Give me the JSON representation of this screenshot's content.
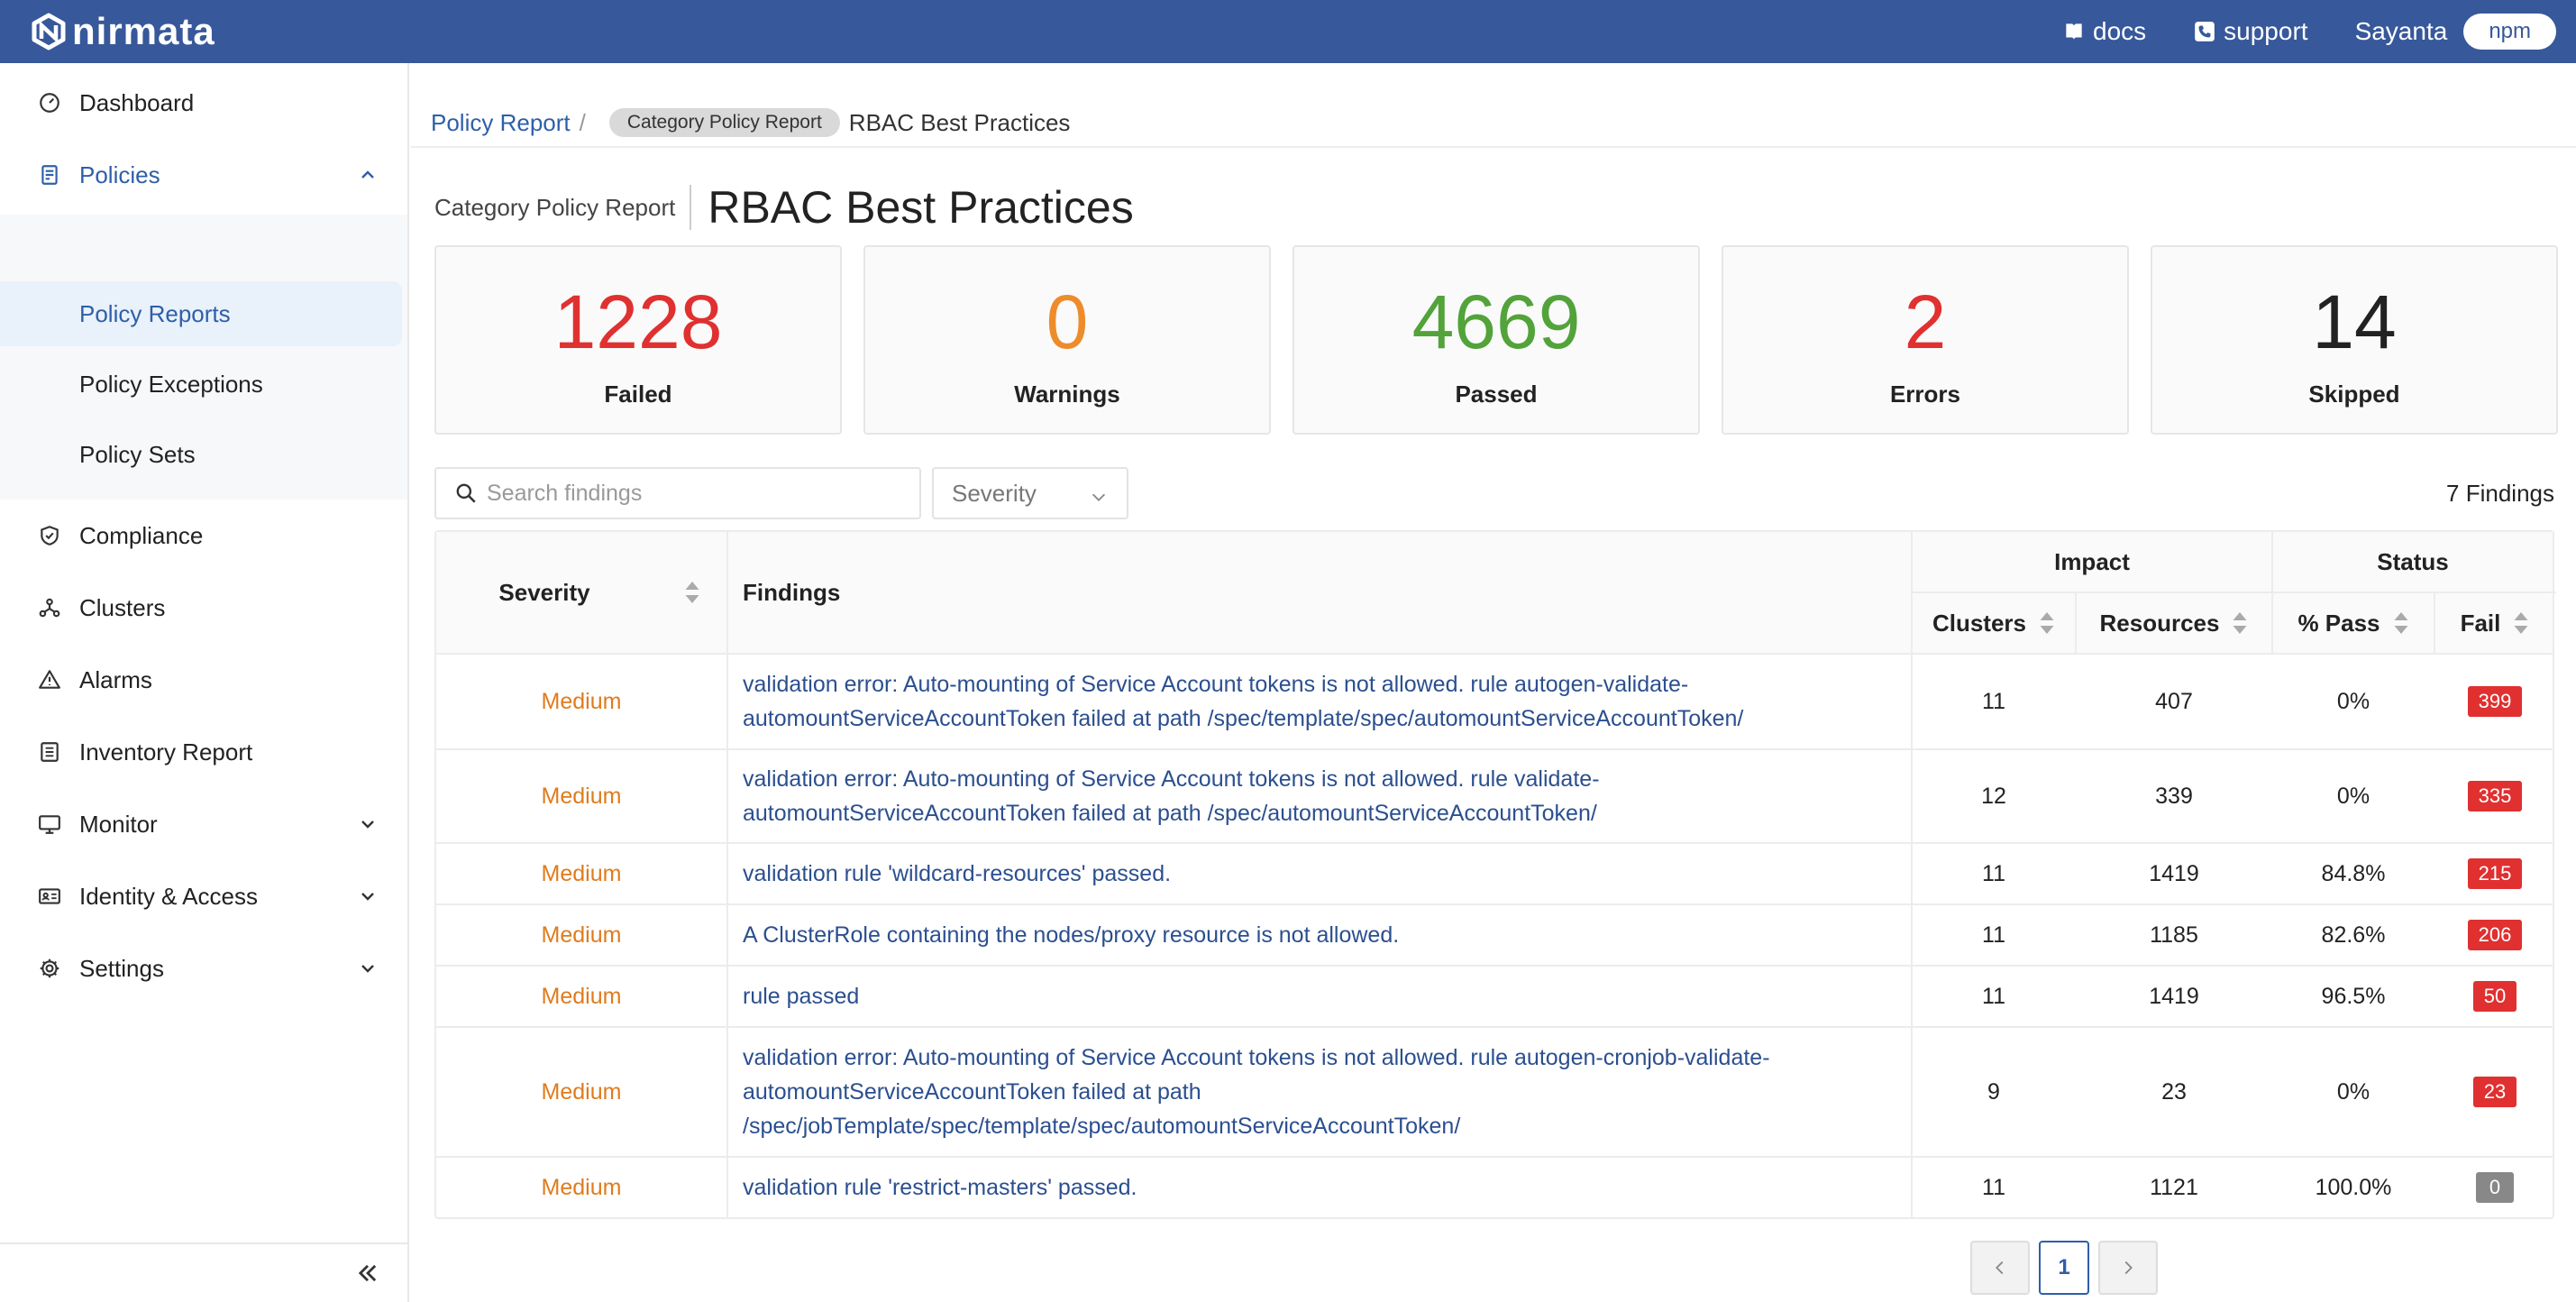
{
  "brand": {
    "name": "nirmata"
  },
  "topnav": {
    "docs": "docs",
    "support": "support",
    "user": "Sayanta",
    "org": "npm"
  },
  "sidebar": {
    "dashboard": "Dashboard",
    "policies": "Policies",
    "policy_reports": "Policy Reports",
    "policy_exceptions": "Policy Exceptions",
    "policy_sets": "Policy Sets",
    "compliance": "Compliance",
    "clusters": "Clusters",
    "alarms": "Alarms",
    "inventory_report": "Inventory Report",
    "monitor": "Monitor",
    "identity_access": "Identity & Access",
    "settings": "Settings"
  },
  "breadcrumb": {
    "root": "Policy Report",
    "sep": "/",
    "chip": "Category Policy Report",
    "current": "RBAC Best Practices"
  },
  "page": {
    "subtitle": "Category Policy Report",
    "title": "RBAC Best Practices"
  },
  "summary": {
    "failed": {
      "value": "1228",
      "label": "Failed",
      "color": "#e03030"
    },
    "warnings": {
      "value": "0",
      "label": "Warnings",
      "color": "#ee8c2b"
    },
    "passed": {
      "value": "4669",
      "label": "Passed",
      "color": "#52a33a"
    },
    "errors": {
      "value": "2",
      "label": "Errors",
      "color": "#e03030"
    },
    "skipped": {
      "value": "14",
      "label": "Skipped",
      "color": "#222222"
    }
  },
  "filters": {
    "search_placeholder": "Search findings",
    "severity": "Severity",
    "count": "7 Findings"
  },
  "table": {
    "headers": {
      "severity": "Severity",
      "findings": "Findings",
      "impact": "Impact",
      "status": "Status",
      "clusters": "Clusters",
      "resources": "Resources",
      "pass": "% Pass",
      "fail": "Fail"
    },
    "rows": [
      {
        "severity": "Medium",
        "finding": "validation error: Auto-mounting of Service Account tokens is not allowed. rule autogen-validate-automountServiceAccountToken failed at path /spec/template/spec/automountServiceAccountToken/",
        "clusters": "11",
        "resources": "407",
        "pass": "0%",
        "fail": "399",
        "fail_color": "#e03030"
      },
      {
        "severity": "Medium",
        "finding": "validation error: Auto-mounting of Service Account tokens is not allowed. rule validate-automountServiceAccountToken failed at path /spec/automountServiceAccountToken/",
        "clusters": "12",
        "resources": "339",
        "pass": "0%",
        "fail": "335",
        "fail_color": "#e03030"
      },
      {
        "severity": "Medium",
        "finding": "validation rule 'wildcard-resources' passed.",
        "clusters": "11",
        "resources": "1419",
        "pass": "84.8%",
        "fail": "215",
        "fail_color": "#e03030"
      },
      {
        "severity": "Medium",
        "finding": "A ClusterRole containing the nodes/proxy resource is not allowed.",
        "clusters": "11",
        "resources": "1185",
        "pass": "82.6%",
        "fail": "206",
        "fail_color": "#e03030"
      },
      {
        "severity": "Medium",
        "finding": "rule passed",
        "clusters": "11",
        "resources": "1419",
        "pass": "96.5%",
        "fail": "50",
        "fail_color": "#e03030"
      },
      {
        "severity": "Medium",
        "finding": "validation error: Auto-mounting of Service Account tokens is not allowed. rule autogen-cronjob-validate-automountServiceAccountToken failed at path /spec/jobTemplate/spec/template/spec/automountServiceAccountToken/",
        "clusters": "9",
        "resources": "23",
        "pass": "0%",
        "fail": "23",
        "fail_color": "#e03030"
      },
      {
        "severity": "Medium",
        "finding": "validation rule 'restrict-masters' passed.",
        "clusters": "11",
        "resources": "1121",
        "pass": "100.0%",
        "fail": "0",
        "fail_color": "#888888"
      }
    ]
  },
  "pagination": {
    "current": "1"
  }
}
